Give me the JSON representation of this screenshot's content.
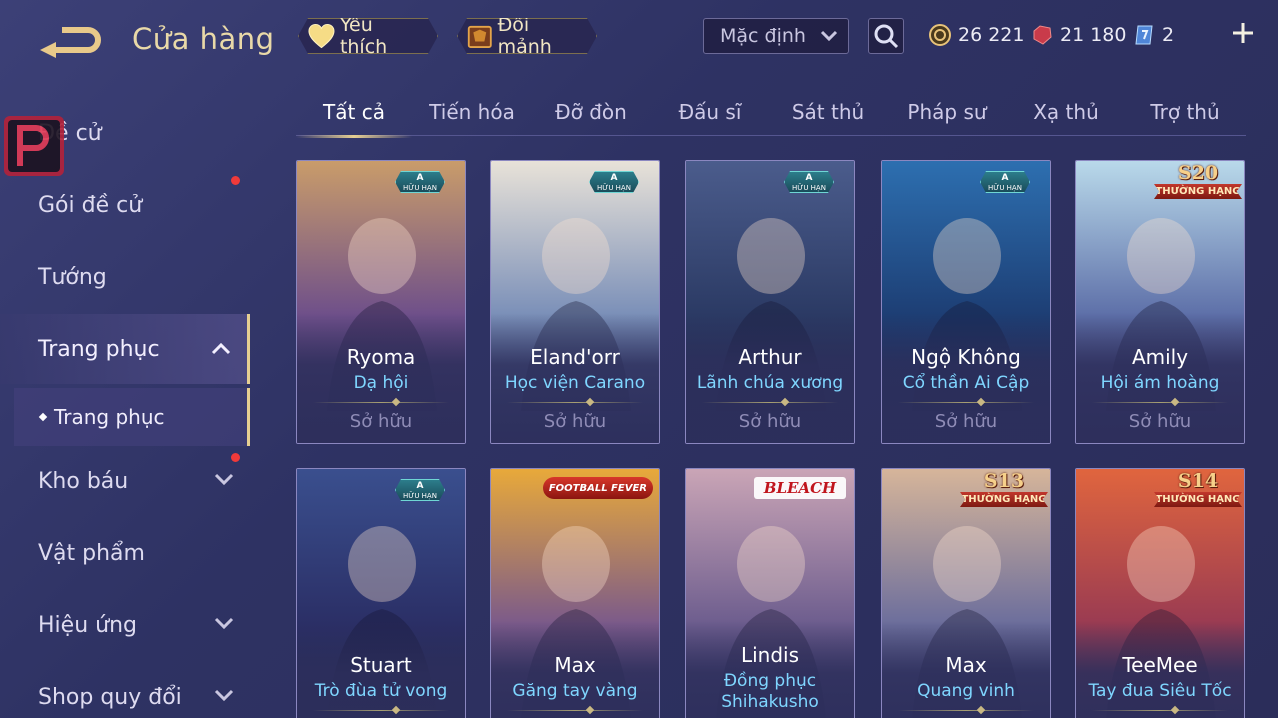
{
  "header": {
    "title": "Cửa hàng",
    "favorite_label": "Yêu thích",
    "trade_label": "Đổi mảnh",
    "sort_selected": "Mặc định",
    "gold": "26 221",
    "ruby": "21 180",
    "voucher": "2"
  },
  "sidebar": {
    "items": [
      {
        "label": "Đề cử"
      },
      {
        "label": "Gói đề cử"
      },
      {
        "label": "Tướng"
      },
      {
        "label": "Trang phục"
      },
      {
        "label": "Trang phục"
      },
      {
        "label": "Kho báu"
      },
      {
        "label": "Vật phẩm"
      },
      {
        "label": "Hiệu ứng"
      },
      {
        "label": "Shop quy đổi"
      }
    ]
  },
  "tabs": [
    {
      "label": "Tất cả"
    },
    {
      "label": "Tiến hóa"
    },
    {
      "label": "Đỡ đòn"
    },
    {
      "label": "Đấu sĩ"
    },
    {
      "label": "Sát thủ"
    },
    {
      "label": "Pháp sư"
    },
    {
      "label": "Xạ thủ"
    },
    {
      "label": "Trợ thủ"
    }
  ],
  "badges": {
    "limited_grade": "A",
    "limited_text": "HỮU HẠN",
    "rank_text": "THƯỜNG HẠNG"
  },
  "cards": [
    {
      "hero": "Ryoma",
      "skin": "Dạ hội",
      "status": "Sở hữu",
      "badge": "limited",
      "art": [
        "#c99c6a",
        "#6e4f8a",
        "#3a2f5e"
      ]
    },
    {
      "hero": "Eland'orr",
      "skin": "Học viện Carano",
      "status": "Sở hữu",
      "badge": "limited",
      "art": [
        "#e8e2d8",
        "#7a8fb8",
        "#3f4b7e"
      ]
    },
    {
      "hero": "Arthur",
      "skin": "Lãnh chúa xương",
      "status": "Sở hữu",
      "badge": "limited",
      "art": [
        "#4b5c8c",
        "#2b3a64",
        "#1e2648"
      ]
    },
    {
      "hero": "Ngộ Không",
      "skin": "Cổ thần Ai Cập",
      "status": "Sở hữu",
      "badge": "limited",
      "art": [
        "#2d6fb0",
        "#1d3e74",
        "#1a2750"
      ]
    },
    {
      "hero": "Amily",
      "skin": "Hội ám hoàng",
      "status": "Sở hữu",
      "badge": "season",
      "season": "S20",
      "art": [
        "#b9d9ea",
        "#5d6fa8",
        "#3b2d5e"
      ]
    },
    {
      "hero": "Stuart",
      "skin": "Trò đùa tử vong",
      "status": "",
      "badge": "limited",
      "art": [
        "#3a4f8e",
        "#2b2f66",
        "#1f2146"
      ]
    },
    {
      "hero": "Max",
      "skin": "Găng tay vàng",
      "status": "",
      "badge": "collab",
      "collab": "FOOTBALL FEVER",
      "art": [
        "#e8a93a",
        "#7b5a8a",
        "#2f2e5c"
      ]
    },
    {
      "hero": "Lindis",
      "skin": "Đồng phục Shihakusho",
      "status": "",
      "badge": "brand",
      "brand": "BLEACH",
      "art": [
        "#caa5b6",
        "#6d5d8e",
        "#2f2e5c"
      ]
    },
    {
      "hero": "Max",
      "skin": "Quang vinh",
      "status": "",
      "badge": "season",
      "season": "S13",
      "art": [
        "#d6b59a",
        "#6c6e9c",
        "#2f2e5c"
      ]
    },
    {
      "hero": "TeeMee",
      "skin": "Tay đua Siêu Tốc",
      "status": "",
      "badge": "season",
      "season": "S14",
      "art": [
        "#e0653e",
        "#9a3b52",
        "#32305e"
      ]
    }
  ],
  "colors": {
    "accent_gold": "#e6cf92",
    "skin_name_blue": "#7fd6ff",
    "notification_red": "#f03a3a"
  }
}
